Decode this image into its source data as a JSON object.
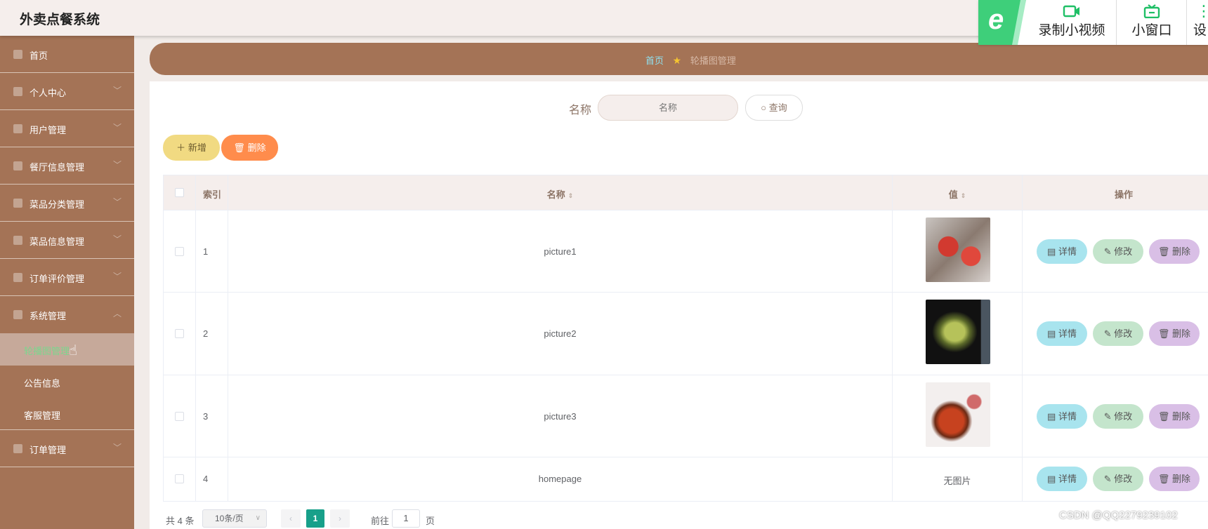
{
  "app": {
    "title": "外卖点餐系统"
  },
  "recorder": {
    "record_label": "录制小视频",
    "window_label": "小窗口",
    "third_label": "设"
  },
  "sidebar": {
    "items": [
      {
        "label": "首页",
        "icon": "home-icon"
      },
      {
        "label": "个人中心",
        "icon": "user-icon"
      },
      {
        "label": "用户管理",
        "icon": "users-icon"
      },
      {
        "label": "餐厅信息管理",
        "icon": "restaurant-icon"
      },
      {
        "label": "菜品分类管理",
        "icon": "category-icon"
      },
      {
        "label": "菜品信息管理",
        "icon": "dish-icon"
      },
      {
        "label": "订单评价管理",
        "icon": "review-icon"
      },
      {
        "label": "系统管理",
        "icon": "system-icon"
      }
    ],
    "sub_items": [
      {
        "label": "轮播图管理",
        "active": true
      },
      {
        "label": "公告信息"
      },
      {
        "label": "客服管理"
      }
    ],
    "last_item": {
      "label": "订单管理",
      "icon": "order-icon"
    }
  },
  "breadcrumb": {
    "home": "首页",
    "current": "轮播图管理"
  },
  "search": {
    "label": "名称",
    "placeholder": "名称",
    "button": "查询"
  },
  "toolbar": {
    "add_label": "新增",
    "delete_label": "删除"
  },
  "table": {
    "headers": {
      "index": "索引",
      "name": "名称",
      "value": "值",
      "ops": "操作"
    },
    "rows": [
      {
        "index": "1",
        "name": "picture1",
        "value": "",
        "has_image": true
      },
      {
        "index": "2",
        "name": "picture2",
        "value": "",
        "has_image": true
      },
      {
        "index": "3",
        "name": "picture3",
        "value": "",
        "has_image": true
      },
      {
        "index": "4",
        "name": "homepage",
        "value": "无图片",
        "has_image": false
      }
    ],
    "ops": {
      "detail": "详情",
      "edit": "修改",
      "delete": "删除"
    }
  },
  "pagination": {
    "total": "共 4 条",
    "page_size": "10条/页",
    "current_page": "1",
    "goto_label": "前往",
    "goto_value": "1",
    "page_word": "页"
  },
  "watermark": "CSDN @QQ2279239102",
  "colors": {
    "sidebar": "#a47356",
    "accent_green": "#18a08a",
    "add_btn": "#f1da82",
    "del_btn": "#ff8c4c"
  }
}
